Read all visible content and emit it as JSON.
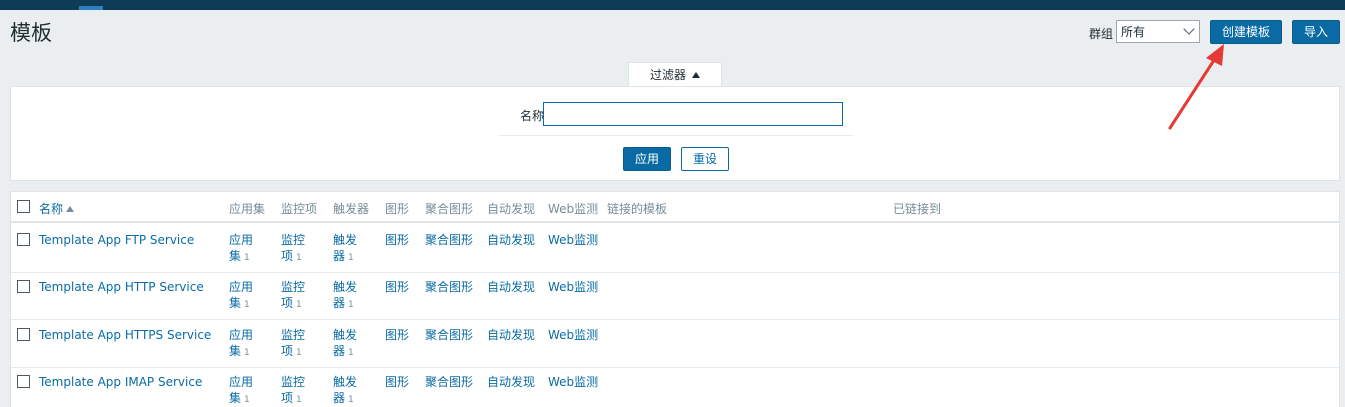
{
  "header": {
    "title": "模板",
    "group_label": "群组",
    "group_value": "所有",
    "create_label": "创建模板",
    "import_label": "导入"
  },
  "filter": {
    "tab_label": "过滤器",
    "name_label": "名称",
    "name_value": "",
    "apply_label": "应用",
    "reset_label": "重设"
  },
  "table": {
    "columns": {
      "name": "名称",
      "apps": "应用集",
      "items": "监控项",
      "triggers": "触发器",
      "graphs": "图形",
      "screens": "聚合图形",
      "discovery": "自动发现",
      "web": "Web监测",
      "linked_templates": "链接的模板",
      "linked_to": "已链接到"
    },
    "rows": [
      {
        "name": "Template App FTP Service",
        "apps_a": "应用",
        "apps_b": "集",
        "apps_count": "1",
        "items_a": "监控",
        "items_b": "项",
        "items_count": "1",
        "triggers_a": "触发",
        "triggers_b": "器",
        "triggers_count": "1",
        "graphs": "图形",
        "screens": "聚合图形",
        "discovery": "自动发现",
        "web": "Web监测"
      },
      {
        "name": "Template App HTTP Service",
        "apps_a": "应用",
        "apps_b": "集",
        "apps_count": "1",
        "items_a": "监控",
        "items_b": "项",
        "items_count": "1",
        "triggers_a": "触发",
        "triggers_b": "器",
        "triggers_count": "1",
        "graphs": "图形",
        "screens": "聚合图形",
        "discovery": "自动发现",
        "web": "Web监测"
      },
      {
        "name": "Template App HTTPS Service",
        "apps_a": "应用",
        "apps_b": "集",
        "apps_count": "1",
        "items_a": "监控",
        "items_b": "项",
        "items_count": "1",
        "triggers_a": "触发",
        "triggers_b": "器",
        "triggers_count": "1",
        "graphs": "图形",
        "screens": "聚合图形",
        "discovery": "自动发现",
        "web": "Web监测"
      },
      {
        "name": "Template App IMAP Service",
        "apps_a": "应用",
        "apps_b": "集",
        "apps_count": "1",
        "items_a": "监控",
        "items_b": "项",
        "items_count": "1",
        "triggers_a": "触发",
        "triggers_b": "器",
        "triggers_count": "1",
        "graphs": "图形",
        "screens": "聚合图形",
        "discovery": "自动发现",
        "web": "Web监测"
      }
    ]
  },
  "colors": {
    "topbar": "#0e3b55",
    "accent": "#0a6ba4",
    "annotation_arrow": "#e53935"
  }
}
